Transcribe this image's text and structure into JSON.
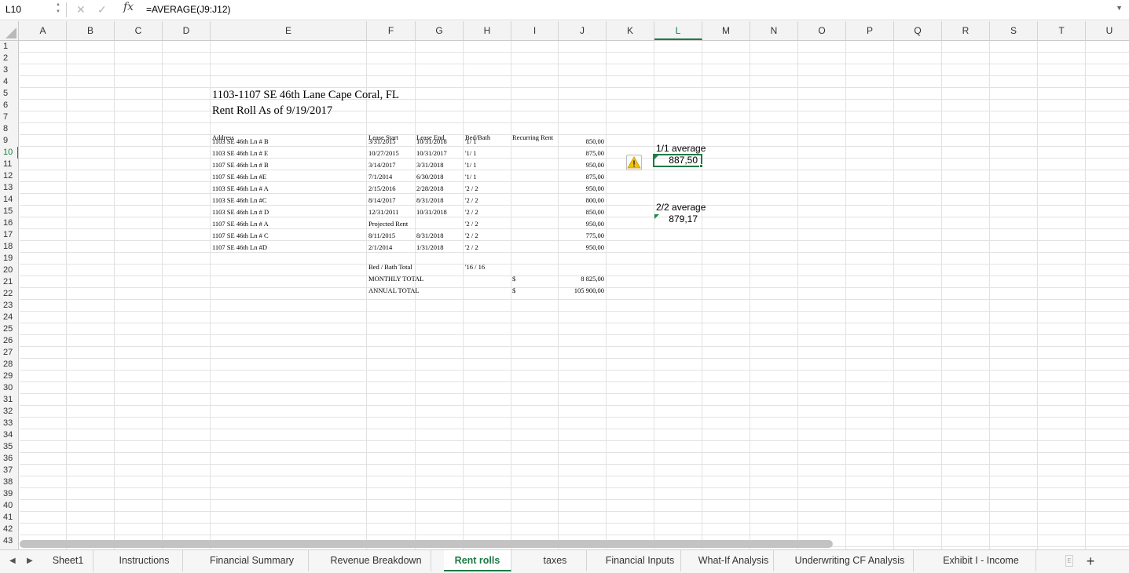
{
  "formula_bar": {
    "name_box": "L10",
    "cancel_glyph": "✕",
    "confirm_glyph": "✓",
    "fx_label": "fx",
    "formula": "=AVERAGE(J9:J12)"
  },
  "columns": [
    "A",
    "B",
    "C",
    "D",
    "E",
    "F",
    "G",
    "H",
    "I",
    "J",
    "K",
    "L",
    "M",
    "N",
    "O",
    "P",
    "Q",
    "R",
    "S",
    "T",
    "U"
  ],
  "selected_column": "L",
  "rows": [
    "1",
    "2",
    "3",
    "4",
    "5",
    "6",
    "7",
    "8",
    "9",
    "10",
    "11",
    "12",
    "13",
    "14",
    "15",
    "16",
    "17",
    "18",
    "19",
    "20",
    "21",
    "22",
    "23",
    "24",
    "25",
    "26",
    "27",
    "28",
    "29",
    "30",
    "31",
    "32",
    "33",
    "34",
    "35",
    "36",
    "37",
    "38",
    "39",
    "40",
    "41",
    "42",
    "43"
  ],
  "selected_row": "10",
  "sheet": {
    "title_line1": "1103-1107 SE 46th Lane Cape Coral, FL",
    "title_line2": "Rent Roll As of 9/19/2017",
    "headers": {
      "address": "Address",
      "lease_start": "Lease Start",
      "lease_end": "Lease End",
      "bed_bath": "Bed/Bath",
      "recurring_rent": "Recurring Rent"
    },
    "units": [
      {
        "address": "1103 SE 46th Ln # B",
        "lease_start": "3/31/2015",
        "lease_end": "10/31/2018",
        "bed_bath": "'1/ 1",
        "rent": "850,00"
      },
      {
        "address": "1103 SE 46th Ln # E",
        "lease_start": "10/27/2015",
        "lease_end": "10/31/2017",
        "bed_bath": "'1/ 1",
        "rent": "875,00"
      },
      {
        "address": "1107 SE 46th Ln # B",
        "lease_start": "3/14/2017",
        "lease_end": "3/31/2018",
        "bed_bath": "'1/ 1",
        "rent": "950,00"
      },
      {
        "address": "1107 SE 46th Ln #E",
        "lease_start": "7/1/2014",
        "lease_end": "6/30/2018",
        "bed_bath": "'1/ 1",
        "rent": "875,00"
      },
      {
        "address": "1103 SE 46th Ln # A",
        "lease_start": "2/15/2016",
        "lease_end": "2/28/2018",
        "bed_bath": "'2 / 2",
        "rent": "950,00"
      },
      {
        "address": "1103 SE 46th Ln #C",
        "lease_start": "8/14/2017",
        "lease_end": "8/31/2018",
        "bed_bath": "'2 / 2",
        "rent": "800,00"
      },
      {
        "address": "1103 SE 46th Ln # D",
        "lease_start": "12/31/2011",
        "lease_end": "10/31/2018",
        "bed_bath": "'2 / 2",
        "rent": "850,00"
      },
      {
        "address": "1107 SE 46th Ln # A",
        "lease_start": "Projected Rent",
        "lease_end": "",
        "bed_bath": "'2 / 2",
        "rent": "950,00"
      },
      {
        "address": "1107 SE 46th Ln # C",
        "lease_start": "8/11/2015",
        "lease_end": "8/31/2018",
        "bed_bath": "'2 / 2",
        "rent": "775,00"
      },
      {
        "address": "1107 SE 46th Ln #D",
        "lease_start": "2/1/2014",
        "lease_end": "1/31/2018",
        "bed_bath": "'2 / 2",
        "rent": "950,00"
      }
    ],
    "bed_bath_total_label": "Bed / Bath Total",
    "bed_bath_total_value": "'16 / 16",
    "monthly_total_label": "MONTHLY TOTAL",
    "monthly_total_currency": "$",
    "monthly_total_value": "8 825,00",
    "annual_total_label": "ANNUAL TOTAL",
    "annual_total_currency": "$",
    "annual_total_value": "105 900,00",
    "avg_11_label": "1/1 average",
    "avg_11_value": "887,50",
    "avg_22_label": "2/2 average",
    "avg_22_value": "879,17"
  },
  "tabs": {
    "prev_glyph": "◀",
    "next_glyph": "▶",
    "items": [
      "Sheet1",
      "Instructions",
      "Financial Summary",
      "Revenue Breakdown",
      "Rent rolls",
      "taxes",
      "Financial Inputs",
      "What-If Analysis",
      "Underwriting CF Analysis",
      "Exhibit I - Income Statement"
    ],
    "active": "Rent rolls",
    "more_glyph": "E",
    "add_glyph": "+"
  },
  "colors": {
    "accent": "#1d7a45",
    "warning": "#f2c200"
  }
}
